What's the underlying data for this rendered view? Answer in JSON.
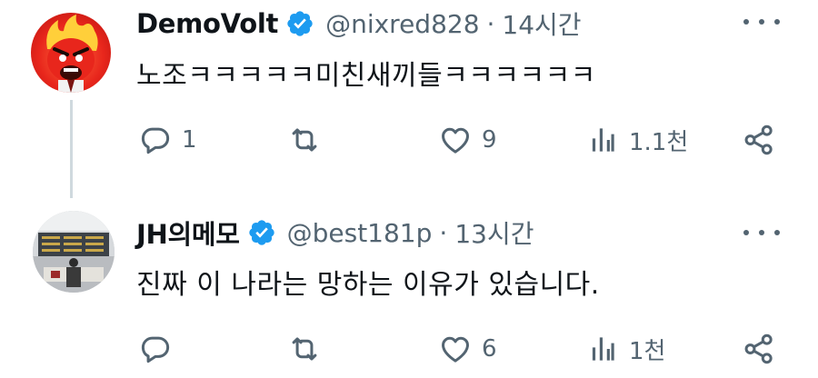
{
  "tweets": [
    {
      "display_name": "DemoVolt",
      "handle": "@nixred828",
      "separator": "·",
      "time": "14시간",
      "text": "노조ㅋㅋㅋㅋㅋ미친새끼들ㅋㅋㅋㅋㅋㅋ",
      "reply_count": "1",
      "retweet_count": "",
      "like_count": "9",
      "view_count": "1.1천"
    },
    {
      "display_name": "JH의메모",
      "handle": "@best181p",
      "separator": "·",
      "time": "13시간",
      "text": "진짜 이 나라는 망하는 이유가 있습니다.",
      "reply_count": "",
      "retweet_count": "",
      "like_count": "6",
      "view_count": "1천"
    }
  ],
  "icons": {
    "verified": "verified-badge-icon",
    "more": "more-options-icon",
    "reply": "reply-icon",
    "retweet": "retweet-icon",
    "like": "heart-icon",
    "views": "views-chart-icon",
    "share": "share-icon"
  },
  "colors": {
    "verified_blue": "#1d9bf0",
    "secondary_text": "#536471",
    "primary_text": "#0f1419"
  }
}
